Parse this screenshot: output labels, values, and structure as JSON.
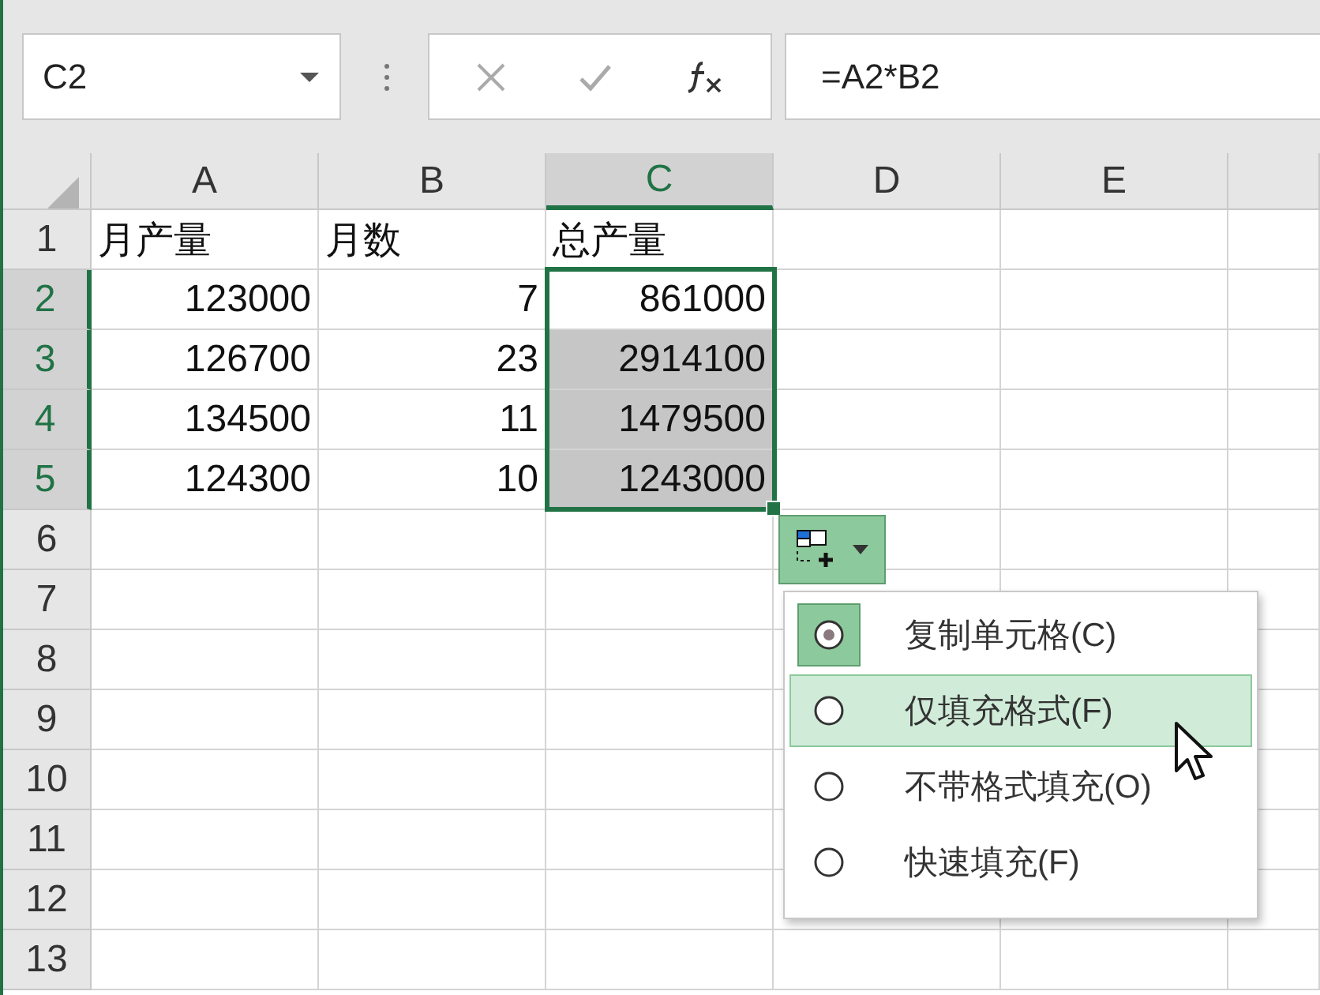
{
  "name_box": {
    "value": "C2"
  },
  "formula_bar": {
    "formula": "=A2*B2"
  },
  "columns": [
    {
      "label": "A",
      "selected": false
    },
    {
      "label": "B",
      "selected": false
    },
    {
      "label": "C",
      "selected": true
    },
    {
      "label": "D",
      "selected": false
    },
    {
      "label": "E",
      "selected": false
    }
  ],
  "rows": [
    {
      "number": "1",
      "selected": false,
      "cells": [
        {
          "text": "月产量",
          "kind": "text",
          "selected": false
        },
        {
          "text": "月数",
          "kind": "text",
          "selected": false
        },
        {
          "text": "总产量",
          "kind": "text",
          "selected": false
        }
      ]
    },
    {
      "number": "2",
      "selected": true,
      "cells": [
        {
          "text": "123000",
          "kind": "number",
          "selected": false
        },
        {
          "text": "7",
          "kind": "number",
          "selected": false
        },
        {
          "text": "861000",
          "kind": "number",
          "selected": false
        }
      ]
    },
    {
      "number": "3",
      "selected": true,
      "cells": [
        {
          "text": "126700",
          "kind": "number",
          "selected": false
        },
        {
          "text": "23",
          "kind": "number",
          "selected": false
        },
        {
          "text": "2914100",
          "kind": "number",
          "selected": true
        }
      ]
    },
    {
      "number": "4",
      "selected": true,
      "cells": [
        {
          "text": "134500",
          "kind": "number",
          "selected": false
        },
        {
          "text": "11",
          "kind": "number",
          "selected": false
        },
        {
          "text": "1479500",
          "kind": "number",
          "selected": true
        }
      ]
    },
    {
      "number": "5",
      "selected": true,
      "cells": [
        {
          "text": "124300",
          "kind": "number",
          "selected": false
        },
        {
          "text": "10",
          "kind": "number",
          "selected": false
        },
        {
          "text": "1243000",
          "kind": "number",
          "selected": true
        }
      ]
    },
    {
      "number": "6",
      "selected": false,
      "cells": []
    },
    {
      "number": "7",
      "selected": false,
      "cells": []
    },
    {
      "number": "8",
      "selected": false,
      "cells": []
    },
    {
      "number": "9",
      "selected": false,
      "cells": []
    },
    {
      "number": "10",
      "selected": false,
      "cells": []
    },
    {
      "number": "11",
      "selected": false,
      "cells": []
    },
    {
      "number": "12",
      "selected": false,
      "cells": []
    },
    {
      "number": "13",
      "selected": false,
      "cells": []
    }
  ],
  "paste_options": {
    "items": [
      {
        "label": "复制单元格(C)",
        "selected": true,
        "hovered": false
      },
      {
        "label": "仅填充格式(F)",
        "selected": false,
        "hovered": true
      },
      {
        "label": "不带格式填充(O)",
        "selected": false,
        "hovered": false
      },
      {
        "label": "快速填充(F)",
        "selected": false,
        "hovered": false
      }
    ]
  }
}
